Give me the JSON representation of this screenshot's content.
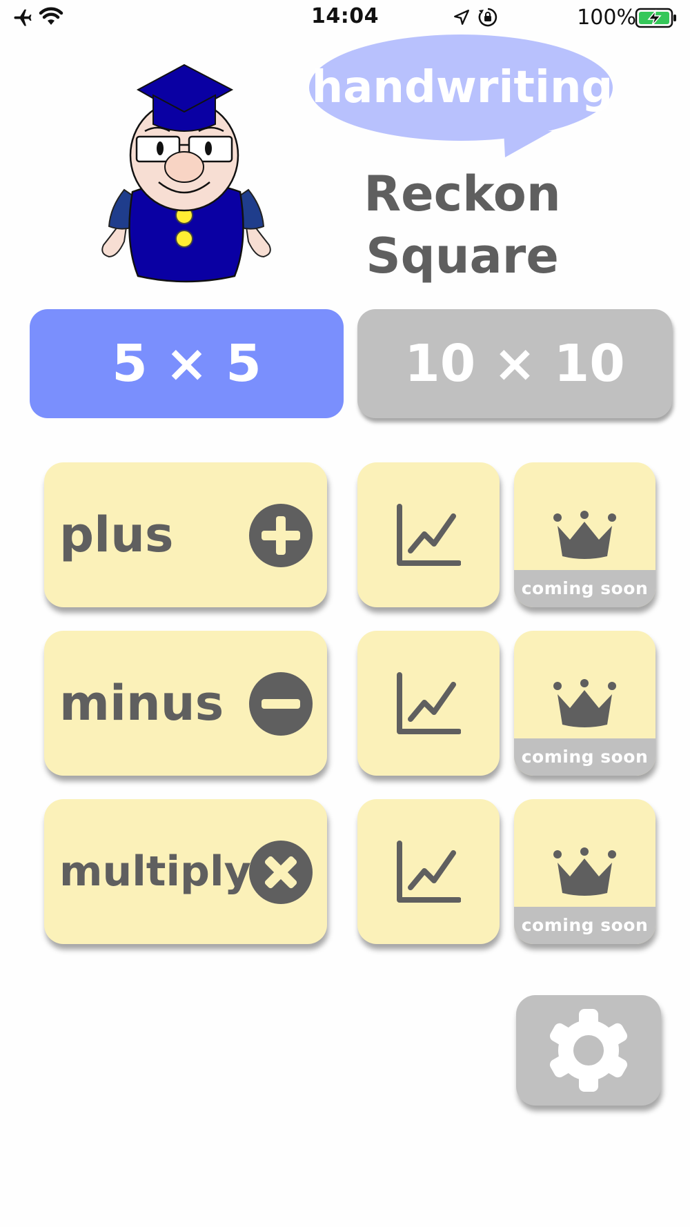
{
  "status_bar": {
    "time": "14:04",
    "battery_percent": "100%"
  },
  "header": {
    "bubble_text": "handwriting",
    "app_title_line1": "Reckon",
    "app_title_line2": "Square"
  },
  "size_options": [
    {
      "label": "5 × 5",
      "selected": true
    },
    {
      "label": "10 × 10",
      "selected": false
    }
  ],
  "operations": [
    {
      "label": "plus",
      "icon": "plus-circle-icon",
      "stats_icon": "line-chart-icon",
      "ranking_icon": "crown-icon",
      "ranking_status": "coming soon"
    },
    {
      "label": "minus",
      "icon": "minus-circle-icon",
      "stats_icon": "line-chart-icon",
      "ranking_icon": "crown-icon",
      "ranking_status": "coming soon"
    },
    {
      "label": "multiply",
      "icon": "multiply-circle-icon",
      "stats_icon": "line-chart-icon",
      "ranking_icon": "crown-icon",
      "ranking_status": "coming soon"
    }
  ],
  "settings": {
    "icon": "gear-icon"
  },
  "colors": {
    "accent_blue": "#7a8ffd",
    "inactive_gray": "#c0c0c0",
    "tile_yellow": "#fbf1b9",
    "text_gray": "#5f5f5f",
    "bubble_blue": "#b8c1fd",
    "battery_green": "#35c759"
  }
}
